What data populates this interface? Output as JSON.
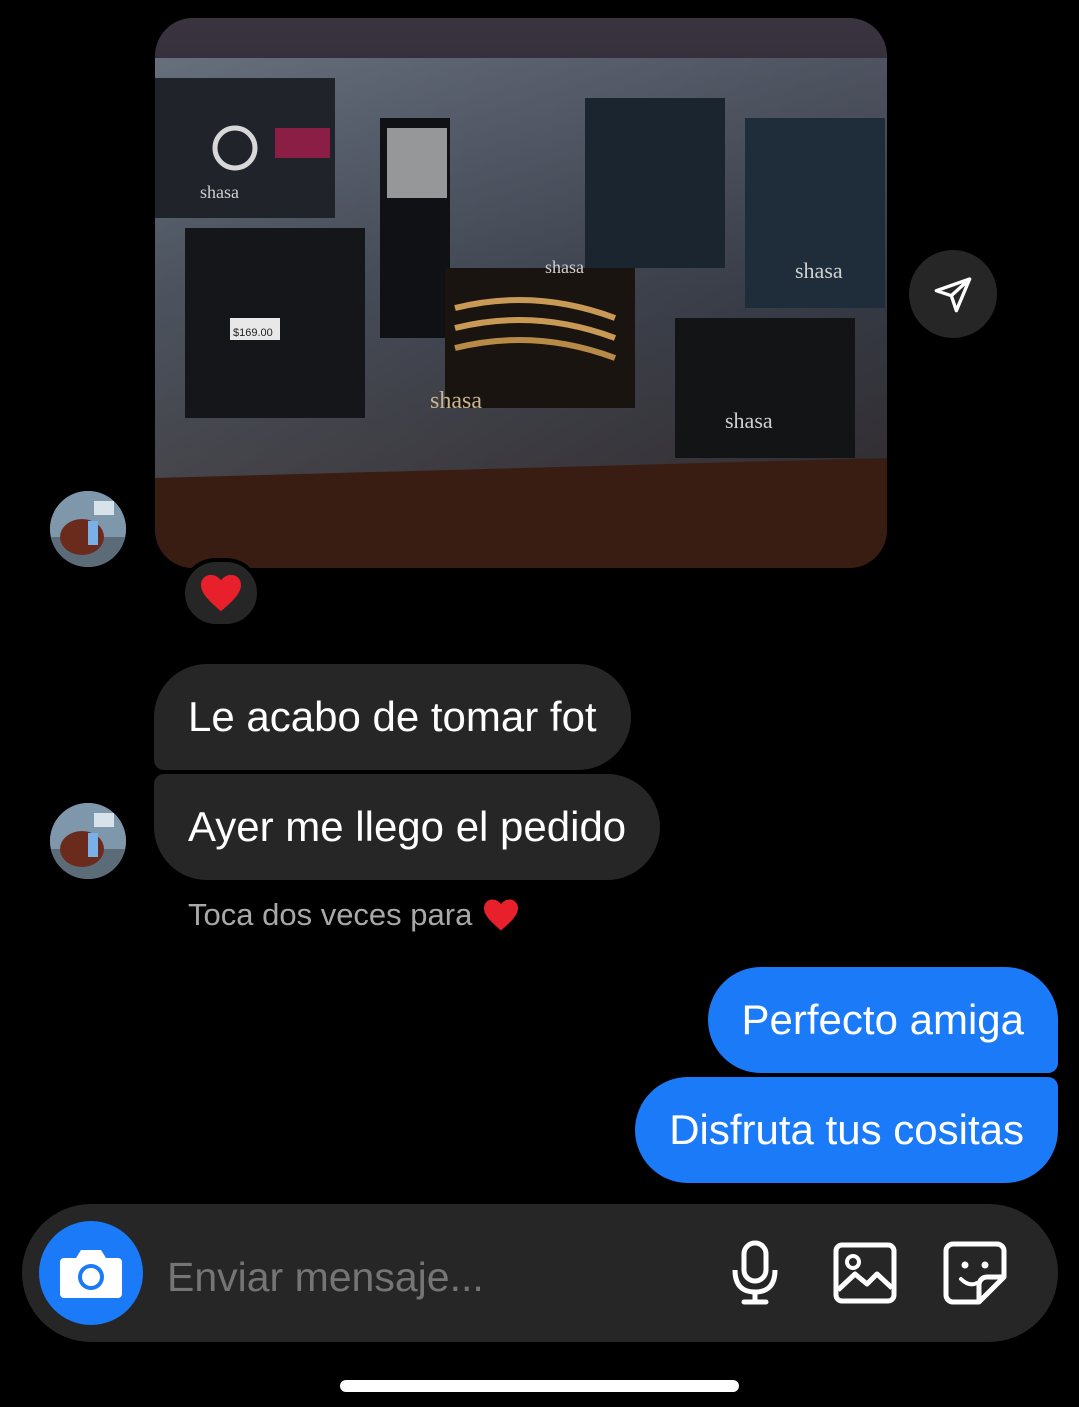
{
  "messages": {
    "incoming_1": "Le acabo de tomar fot",
    "incoming_2": "Ayer me llego el pedido",
    "hint": "Toca dos veces para",
    "outgoing_1": "Perfecto amiga",
    "outgoing_2": "Disfruta tus cositas"
  },
  "photo": {
    "brand_labels": [
      "shasa",
      "shasa",
      "shasa",
      "shasa",
      "shasa"
    ],
    "price_tag": "$169.00"
  },
  "reaction": {
    "emoji": "❤️"
  },
  "composer": {
    "placeholder": "Enviar mensaje...",
    "icons": [
      "camera-icon",
      "microphone-icon",
      "gallery-icon",
      "sticker-icon"
    ]
  },
  "colors": {
    "accent": "#1a7af8",
    "bubble_in": "#262626",
    "background": "#000000",
    "heart": "#e8202b"
  }
}
